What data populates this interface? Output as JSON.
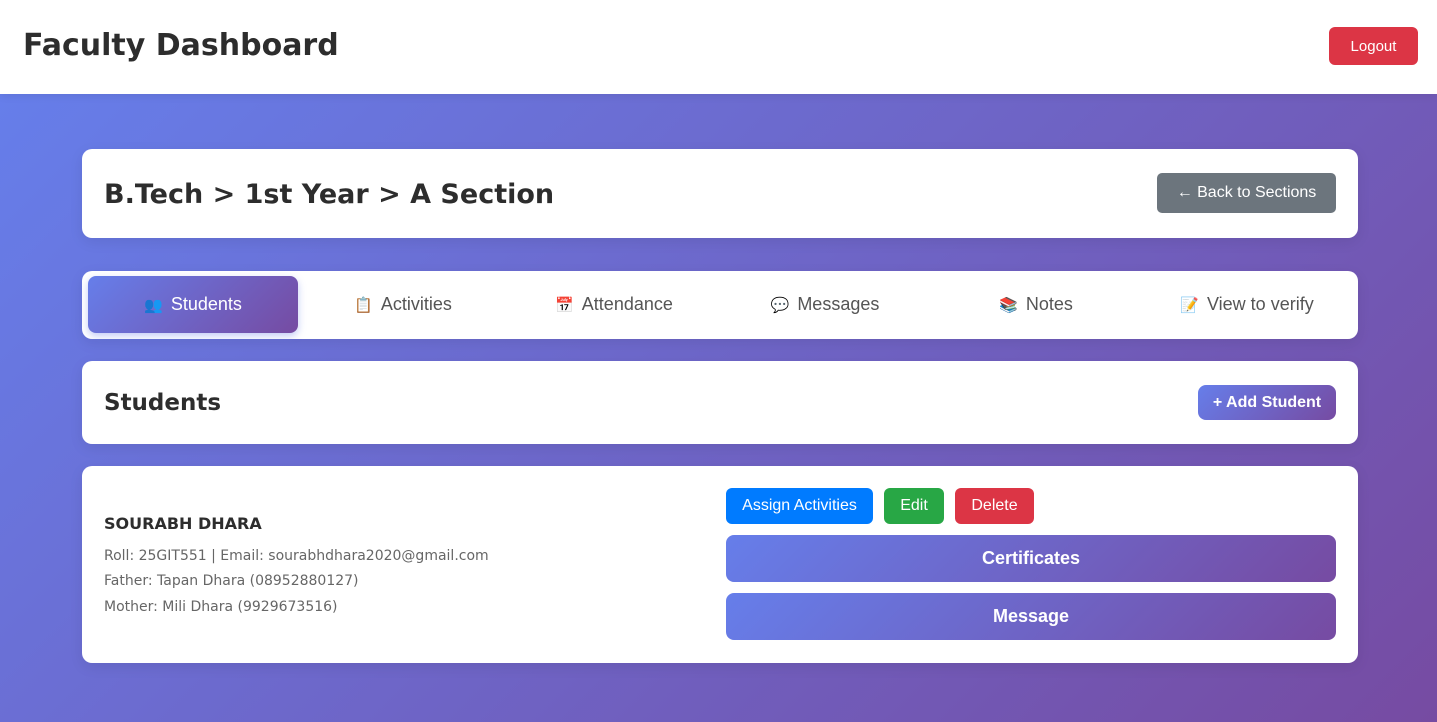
{
  "header": {
    "title": "Faculty Dashboard",
    "logout_label": "Logout"
  },
  "breadcrumb": {
    "text": "B.Tech > 1st Year > A Section",
    "back_label": "← Back to Sections"
  },
  "tabs": [
    {
      "label": "Students",
      "icon": "👥",
      "icon_name": "users-icon",
      "active": true
    },
    {
      "label": "Activities",
      "icon": "📋",
      "icon_name": "clipboard-icon",
      "active": false
    },
    {
      "label": "Attendance",
      "icon": "📅",
      "icon_name": "calendar-icon",
      "active": false
    },
    {
      "label": "Messages",
      "icon": "💬",
      "icon_name": "speech-bubble-icon",
      "active": false
    },
    {
      "label": "Notes",
      "icon": "📚",
      "icon_name": "books-icon",
      "active": false
    },
    {
      "label": "View to verify",
      "icon": "📝",
      "icon_name": "memo-icon",
      "active": false
    }
  ],
  "students_section": {
    "title": "Students",
    "add_label": "+ Add Student"
  },
  "student": {
    "name": "SOURABH DHARA",
    "roll_email": "Roll: 25GIT551 | Email: sourabhdhara2020@gmail.com",
    "father": "Father: Tapan Dhara (08952880127)",
    "mother": "Mother: Mili Dhara (9929673516)",
    "assign_label": "Assign Activities",
    "edit_label": "Edit",
    "delete_label": "Delete",
    "certificates_label": "Certificates",
    "message_label": "Message"
  },
  "colors": {
    "gradient_start": "#667eea",
    "gradient_end": "#764ba2",
    "danger": "#dc3545",
    "primary": "#007bff",
    "success": "#28a745",
    "secondary": "#6c757d"
  }
}
